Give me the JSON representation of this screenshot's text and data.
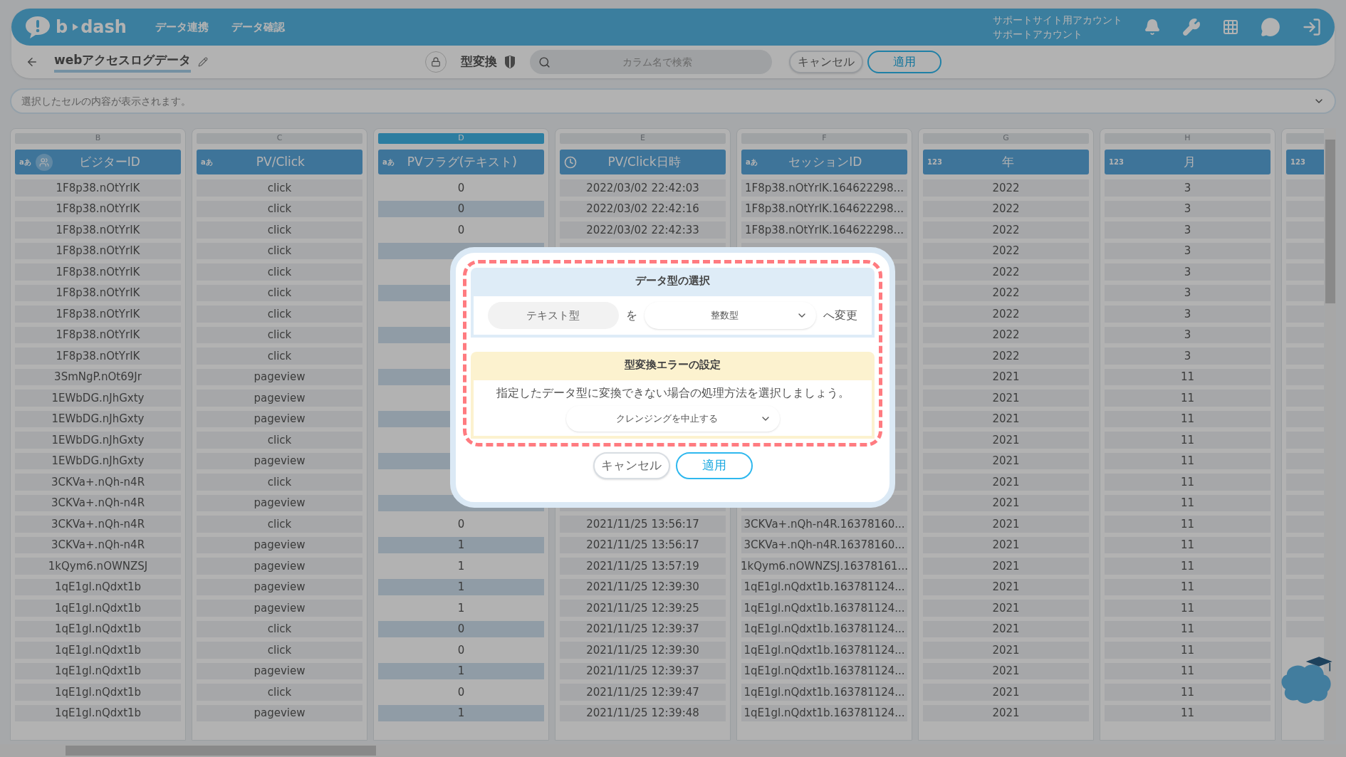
{
  "nav": {
    "logo": [
      "b",
      "dash"
    ],
    "links": [
      "データ連携",
      "データ確認"
    ],
    "account_lines": [
      "サポートサイト用アカウント",
      "サポートアカウント"
    ]
  },
  "toolbar": {
    "title": "webアクセスログデータ",
    "mode": "型変換",
    "search": {
      "placeholder": "カラム名で検索"
    },
    "buttons": [
      {
        "label": "キャンセル",
        "kind": "secondary"
      },
      {
        "label": "適用",
        "kind": "primary"
      }
    ]
  },
  "cell_preview": {
    "placeholder": "選択したセルの内容が表示されます。"
  },
  "table": {
    "columns": [
      {
        "letter": "B",
        "name": "ビジターID",
        "kind": "text",
        "type_mark": "aあ",
        "selected": false
      },
      {
        "letter": "C",
        "name": "PV/Click",
        "kind": "text",
        "type_mark": "aあ",
        "selected": false
      },
      {
        "letter": "D",
        "name": "PVフラグ(テキスト)",
        "kind": "text",
        "type_mark": "aあ",
        "selected": true
      },
      {
        "letter": "E",
        "name": "PV/Click日時",
        "kind": "datetime",
        "selected": false
      },
      {
        "letter": "F",
        "name": "セッションID",
        "kind": "text",
        "type_mark": "aあ",
        "selected": false
      },
      {
        "letter": "G",
        "name": "年",
        "kind": "number",
        "type_mark": "123",
        "selected": false
      },
      {
        "letter": "H",
        "name": "月",
        "kind": "number",
        "type_mark": "123",
        "selected": false
      },
      {
        "kind": "number",
        "type_mark": "123",
        "selected": false
      }
    ],
    "rows": [
      [
        "1F8p38.nOtYrIK",
        "click",
        "0",
        "2022/03/02 22:42:03",
        "1F8p38.nOtYrIK.164622298...",
        "2022",
        "3"
      ],
      [
        "1F8p38.nOtYrIK",
        "click",
        "0",
        "2022/03/02 22:42:16",
        "1F8p38.nOtYrIK.164622298...",
        "2022",
        "3"
      ],
      [
        "1F8p38.nOtYrIK",
        "click",
        "0",
        "2022/03/02 22:42:33",
        "1F8p38.nOtYrIK.164622298...",
        "2022",
        "3"
      ],
      [
        "1F8p38.nOtYrIK",
        "click",
        null,
        null,
        null,
        "2022",
        "3"
      ],
      [
        "1F8p38.nOtYrIK",
        "click",
        null,
        null,
        null,
        "2022",
        "3"
      ],
      [
        "1F8p38.nOtYrIK",
        "click",
        null,
        null,
        null,
        "2022",
        "3"
      ],
      [
        "1F8p38.nOtYrIK",
        "click",
        null,
        null,
        null,
        "2022",
        "3"
      ],
      [
        "1F8p38.nOtYrIK",
        "click",
        null,
        null,
        null,
        "2022",
        "3"
      ],
      [
        "1F8p38.nOtYrIK",
        "click",
        null,
        null,
        null,
        "2022",
        "3"
      ],
      [
        "3SmNgP.nOt69Jr",
        "pageview",
        null,
        null,
        null,
        "2021",
        "11"
      ],
      [
        "1EWbDG.nJhGxty",
        "pageview",
        null,
        null,
        null,
        "2021",
        "11"
      ],
      [
        "1EWbDG.nJhGxty",
        "pageview",
        null,
        null,
        null,
        "2021",
        "11"
      ],
      [
        "1EWbDG.nJhGxty",
        "click",
        null,
        null,
        null,
        "2021",
        "11"
      ],
      [
        "1EWbDG.nJhGxty",
        "pageview",
        null,
        null,
        null,
        "2021",
        "11"
      ],
      [
        "3CKVa+.nQh-n4R",
        "click",
        null,
        null,
        null,
        "2021",
        "11"
      ],
      [
        "3CKVa+.nQh-n4R",
        "pageview",
        null,
        null,
        null,
        "2021",
        "11"
      ],
      [
        "3CKVa+.nQh-n4R",
        "click",
        "0",
        "2021/11/25 13:56:17",
        "3CKVa+.nQh-n4R.16378160...",
        "2021",
        "11"
      ],
      [
        "3CKVa+.nQh-n4R",
        "pageview",
        "1",
        "2021/11/25 13:56:17",
        "3CKVa+.nQh-n4R.16378160...",
        "2021",
        "11"
      ],
      [
        "1kQym6.nOWNZSJ",
        "pageview",
        "1",
        "2021/11/25 13:57:19",
        "1kQym6.nOWNZSJ.16378161...",
        "2021",
        "11"
      ],
      [
        "1qE1gl.nQdxt1b",
        "pageview",
        "1",
        "2021/11/25 12:39:30",
        "1qE1gl.nQdxt1b.163781124...",
        "2021",
        "11"
      ],
      [
        "1qE1gl.nQdxt1b",
        "pageview",
        "1",
        "2021/11/25 12:39:25",
        "1qE1gl.nQdxt1b.163781124...",
        "2021",
        "11"
      ],
      [
        "1qE1gl.nQdxt1b",
        "click",
        "0",
        "2021/11/25 12:39:37",
        "1qE1gl.nQdxt1b.163781124...",
        "2021",
        "11"
      ],
      [
        "1qE1gl.nQdxt1b",
        "click",
        "0",
        "2021/11/25 12:39:30",
        "1qE1gl.nQdxt1b.163781124...",
        "2021",
        "11"
      ],
      [
        "1qE1gl.nQdxt1b",
        "pageview",
        "1",
        "2021/11/25 12:39:37",
        "1qE1gl.nQdxt1b.163781124...",
        "2021",
        "11"
      ],
      [
        "1qE1gl.nQdxt1b",
        "click",
        "0",
        "2021/11/25 12:39:47",
        "1qE1gl.nQdxt1b.163781124...",
        "2021",
        "11"
      ],
      [
        "1qE1gl.nQdxt1b",
        "pageview",
        "1",
        "2021/11/25 12:39:48",
        "1qE1gl.nQdxt1b.163781124...",
        "2021",
        "11"
      ]
    ]
  },
  "modal": {
    "type_section": {
      "title": "データ型の選択",
      "from_type": "テキスト型",
      "particle": "を",
      "to_type": "整数型",
      "suffix": "へ変更"
    },
    "error_section": {
      "title": "型変換エラーの設定",
      "description": "指定したデータ型に変換できない場合の処理方法を選択しましょう。",
      "action": "クレンジングを中止する"
    },
    "buttons": [
      {
        "label": "キャンセル",
        "kind": "secondary"
      },
      {
        "label": "適用",
        "kind": "primary"
      }
    ]
  }
}
